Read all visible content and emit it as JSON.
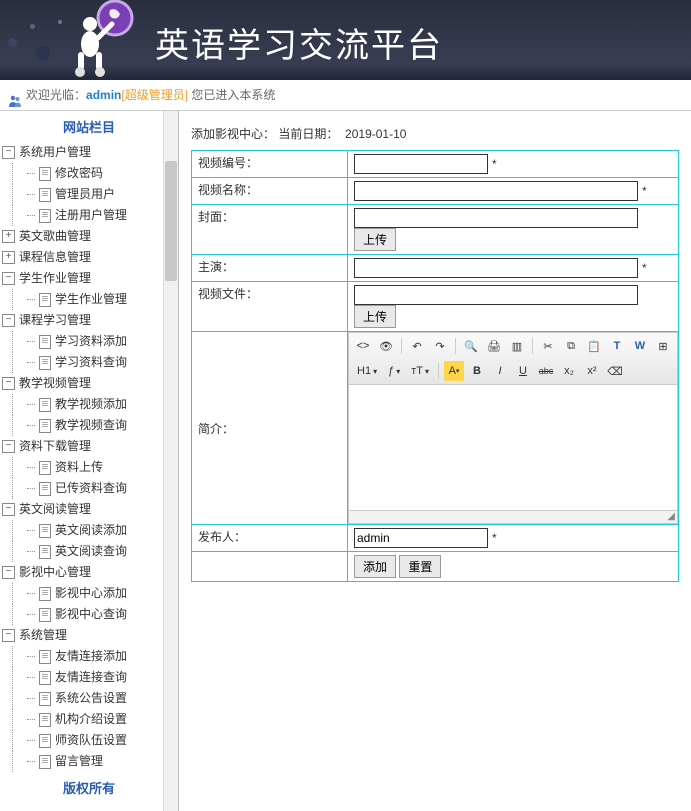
{
  "header": {
    "title": "英语学习交流平台"
  },
  "welcome": {
    "prefix": "欢迎光临：",
    "user": "admin",
    "role": "[超级管理员]",
    "suffix": " 您已进入本系统"
  },
  "sidebar": {
    "heading": "网站栏目",
    "footer": "版权所有",
    "groups": [
      {
        "label": "系统用户管理",
        "pm": "−",
        "children": [
          "修改密码",
          "管理员用户",
          "注册用户管理"
        ]
      },
      {
        "label": "英文歌曲管理",
        "pm": "+",
        "children": []
      },
      {
        "label": "课程信息管理",
        "pm": "+",
        "children": []
      },
      {
        "label": "学生作业管理",
        "pm": "−",
        "children": [
          "学生作业管理"
        ]
      },
      {
        "label": "课程学习管理",
        "pm": "−",
        "children": [
          "学习资料添加",
          "学习资料查询"
        ]
      },
      {
        "label": "教学视频管理",
        "pm": "−",
        "children": [
          "教学视频添加",
          "教学视频查询"
        ]
      },
      {
        "label": "资料下载管理",
        "pm": "−",
        "children": [
          "资料上传",
          "已传资料查询"
        ]
      },
      {
        "label": "英文阅读管理",
        "pm": "−",
        "children": [
          "英文阅读添加",
          "英文阅读查询"
        ]
      },
      {
        "label": "影视中心管理",
        "pm": "−",
        "children": [
          "影视中心添加",
          "影视中心查询"
        ]
      },
      {
        "label": "系统管理",
        "pm": "−",
        "children": [
          "友情连接添加",
          "友情连接查询",
          "系统公告设置",
          "机构介绍设置",
          "师资队伍设置",
          "留言管理"
        ]
      }
    ]
  },
  "page": {
    "title_prefix": "添加影视中心：",
    "date_label": "当前日期：",
    "date_value": "2019-01-10"
  },
  "form": {
    "fields": {
      "video_no": {
        "label": "视频编号：",
        "value": "",
        "star": "*"
      },
      "video_name": {
        "label": "视频名称：",
        "value": "",
        "star": "*"
      },
      "cover": {
        "label": "封面：",
        "value": "",
        "upload": "上传"
      },
      "actor": {
        "label": "主演：",
        "value": "",
        "star": "*"
      },
      "video_file": {
        "label": "视频文件：",
        "value": "",
        "upload": "上传"
      },
      "intro": {
        "label": "简介："
      },
      "publisher": {
        "label": "发布人：",
        "value": "admin",
        "star": "*"
      }
    },
    "buttons": {
      "submit": "添加",
      "reset": "重置"
    }
  },
  "editor_icons": {
    "row1": [
      "source-icon",
      "preview-icon",
      "undo-icon",
      "redo-icon",
      "find-icon",
      "print-icon",
      "template-icon",
      "cut-icon",
      "copy-icon",
      "paste-icon",
      "paste-text-icon",
      "paste-word-icon",
      "insert-icon"
    ],
    "row2_sel": [
      "H1",
      "ƒ",
      "тT"
    ],
    "row2_btn": [
      "bgcolor-icon",
      "bold-icon",
      "italic-icon",
      "underline-icon",
      "strike-icon",
      "sub-icon",
      "sup-icon",
      "remove-format-icon"
    ]
  }
}
